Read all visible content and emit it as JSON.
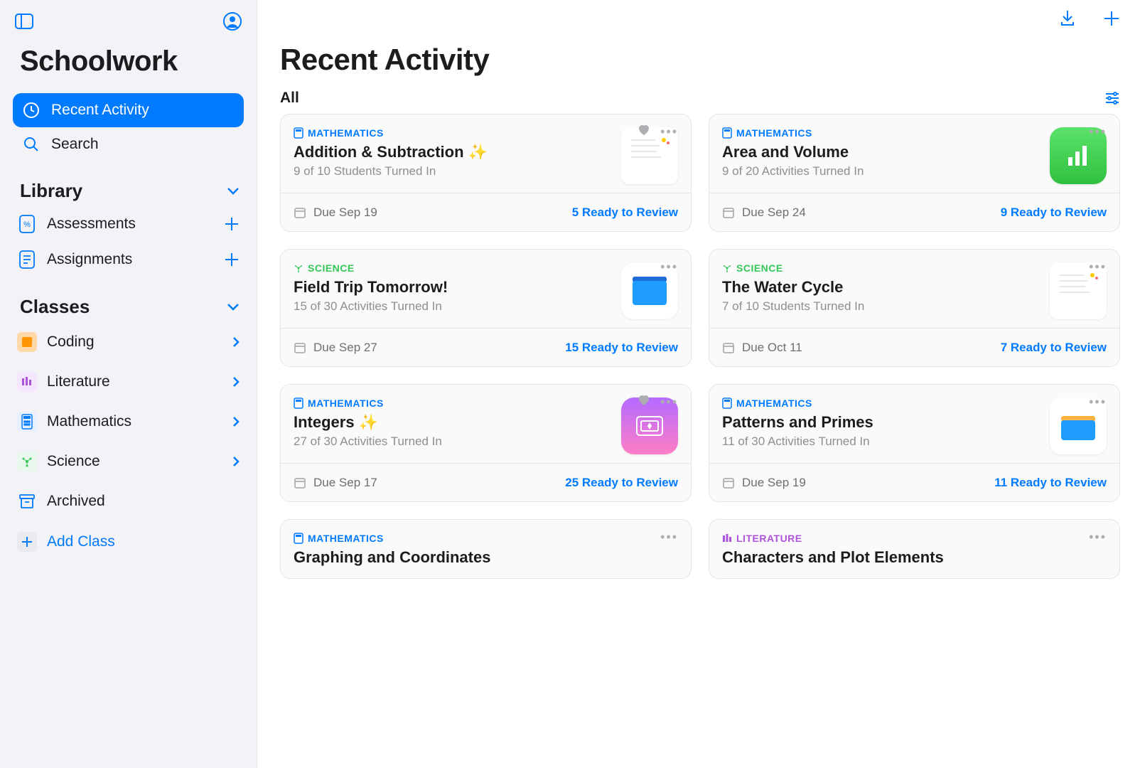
{
  "app_title": "Schoolwork",
  "sidebar": {
    "nav": [
      {
        "label": "Recent Activity",
        "active": true
      },
      {
        "label": "Search",
        "active": false
      }
    ],
    "library_label": "Library",
    "library": [
      {
        "label": "Assessments"
      },
      {
        "label": "Assignments"
      }
    ],
    "classes_label": "Classes",
    "classes": [
      {
        "label": "Coding"
      },
      {
        "label": "Literature"
      },
      {
        "label": "Mathematics"
      },
      {
        "label": "Science"
      },
      {
        "label": "Archived"
      }
    ],
    "add_class_label": "Add Class"
  },
  "main": {
    "title": "Recent Activity",
    "filter_label": "All",
    "cards": [
      {
        "subject": "MATHEMATICS",
        "subject_key": "math",
        "title": "Addition & Subtraction ✨",
        "subtitle": "9 of 10 Students Turned In",
        "due": "Due Sep 19",
        "review": "5 Ready to Review",
        "fav": true,
        "thumb": "doc"
      },
      {
        "subject": "MATHEMATICS",
        "subject_key": "math",
        "title": "Area and Volume",
        "subtitle": "9 of 20 Activities Turned In",
        "due": "Due Sep 24",
        "review": "9 Ready to Review",
        "fav": false,
        "thumb": "numbers"
      },
      {
        "subject": "SCIENCE",
        "subject_key": "sci",
        "title": "Field Trip Tomorrow!",
        "subtitle": "15 of 30 Activities Turned In",
        "due": "Due Sep 27",
        "review": "15 Ready to Review",
        "fav": false,
        "thumb": "files"
      },
      {
        "subject": "SCIENCE",
        "subject_key": "sci",
        "title": "The Water Cycle",
        "subtitle": "7 of 10 Students Turned In",
        "due": "Due Oct 11",
        "review": "7 Ready to Review",
        "fav": false,
        "thumb": "doc"
      },
      {
        "subject": "MATHEMATICS",
        "subject_key": "math",
        "title": "Integers ✨",
        "subtitle": "27 of 30 Activities Turned In",
        "due": "Due Sep 17",
        "review": "25 Ready to Review",
        "fav": true,
        "thumb": "purple"
      },
      {
        "subject": "MATHEMATICS",
        "subject_key": "math",
        "title": "Patterns and Primes",
        "subtitle": "11 of 30 Activities Turned In",
        "due": "Due Sep 19",
        "review": "11 Ready to Review",
        "fav": false,
        "thumb": "folder2"
      },
      {
        "subject": "MATHEMATICS",
        "subject_key": "math",
        "title": "Graphing and Coordinates",
        "subtitle": "",
        "due": "",
        "review": "",
        "fav": false,
        "thumb": ""
      },
      {
        "subject": "LITERATURE",
        "subject_key": "lit",
        "title": "Characters and Plot Elements",
        "subtitle": "",
        "due": "",
        "review": "",
        "fav": false,
        "thumb": ""
      }
    ]
  }
}
